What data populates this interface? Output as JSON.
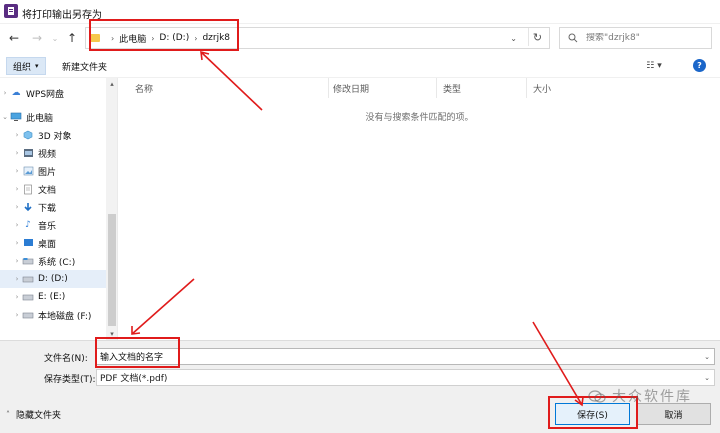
{
  "window": {
    "title": "将打印输出另存为"
  },
  "nav": {
    "back": "←",
    "forward": "→",
    "up": "↑",
    "dropdown": "⌄"
  },
  "address": {
    "crumbs": [
      "此电脑",
      "D: (D:)",
      "dzrjk8"
    ],
    "refresh": "↻"
  },
  "search": {
    "placeholder": "搜索\"dzrjk8\""
  },
  "toolbar": {
    "organize_label": "组织",
    "new_folder_label": "新建文件夹",
    "view_label": "☷ ▾",
    "help_label": "?"
  },
  "sidebar": {
    "items": [
      {
        "label": "WPS网盘",
        "icon": "cloud-icon"
      },
      {
        "label": "此电脑",
        "icon": "computer-icon"
      },
      {
        "label": "3D 对象",
        "icon": "cube-icon"
      },
      {
        "label": "视频",
        "icon": "video-icon"
      },
      {
        "label": "图片",
        "icon": "picture-icon"
      },
      {
        "label": "文档",
        "icon": "document-icon"
      },
      {
        "label": "下载",
        "icon": "download-icon"
      },
      {
        "label": "音乐",
        "icon": "music-icon"
      },
      {
        "label": "桌面",
        "icon": "desktop-icon"
      },
      {
        "label": "系统 (C:)",
        "icon": "drive-icon"
      },
      {
        "label": "D: (D:)",
        "icon": "drive-icon"
      },
      {
        "label": "E:   (E:)",
        "icon": "drive-icon"
      },
      {
        "label": "本地磁盘 (F:)",
        "icon": "drive-icon"
      }
    ]
  },
  "columns": {
    "name": "名称",
    "modified": "修改日期",
    "type": "类型",
    "size": "大小"
  },
  "files": {
    "empty_message": "没有与搜索条件匹配的项。"
  },
  "form": {
    "filename_label": "文件名(N):",
    "filename_value": "输入文档的名字",
    "filetype_label": "保存类型(T):",
    "filetype_value": "PDF 文档(*.pdf)"
  },
  "footer": {
    "hide_folders_label": "隐藏文件夹",
    "save_label": "保存(S)",
    "cancel_label": "取消"
  },
  "watermark": {
    "text": "大众软件库"
  },
  "colors": {
    "annotation_red": "#e01b1b",
    "accent_blue": "#0078d7"
  }
}
